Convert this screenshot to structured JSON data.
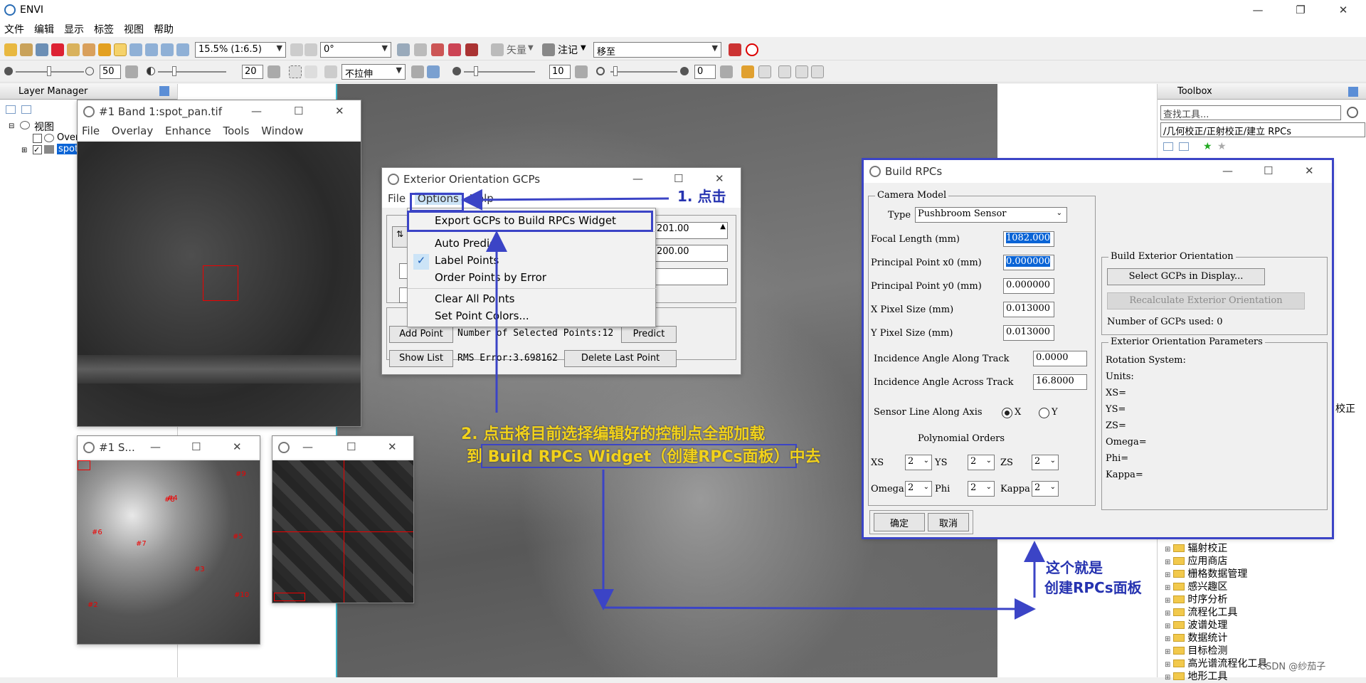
{
  "app": {
    "title": "ENVI",
    "min": "—",
    "restore": "❐",
    "close": "✕"
  },
  "menubar": [
    "文件",
    "编辑",
    "显示",
    "标签",
    "视图",
    "帮助"
  ],
  "toolbar1": {
    "zoom": "15.5% (1:6.5)",
    "rotation": "0°",
    "vector_label": "矢量",
    "annotation_label": "注记",
    "mode": "移至"
  },
  "toolbar2": {
    "brightness": "50",
    "contrast": "20",
    "stretch": "不拉伸",
    "sharpen": "10",
    "transparency": "0"
  },
  "layer_manager": {
    "title": "Layer Manager",
    "root": "视图",
    "items": [
      "Overview",
      "spot_pan.tif"
    ]
  },
  "toolbox": {
    "title": "Toolbox",
    "search_placeholder": "查找工具...",
    "path": "/几何校正/正射校正/建立 RPCs",
    "truncated_label": "校正",
    "tree": [
      "辐射校正",
      "应用商店",
      "栅格数据管理",
      "感兴趣区",
      "时序分析",
      "流程化工具",
      "波谱处理",
      "数据统计",
      "目标检测",
      "高光谱流程化工具",
      "地形工具"
    ]
  },
  "band_window": {
    "title": "#1 Band 1:spot_pan.tif",
    "menu": [
      "File",
      "Overlay",
      "Enhance",
      "Tools",
      "Window"
    ]
  },
  "scroll_window": {
    "title": "#1 S..."
  },
  "zoom_window": {
    "title": ""
  },
  "gcp_points": [
    "#9",
    "#4",
    "#8",
    "#6",
    "#7",
    "#5",
    "#3",
    "#10",
    "#2"
  ],
  "gcp_dialog": {
    "title": "Exterior Orientation GCPs",
    "menu": [
      "File",
      "Options",
      "Help"
    ],
    "options_menu": [
      "Export GCPs to Build RPCs Widget",
      "Auto Predict",
      "Label Points",
      "Order Points by Error",
      "Clear All Points",
      "Set Point Colors..."
    ],
    "val1": "201.00",
    "val2": "200.00",
    "add_point": "Add Point",
    "num_selected": "Number of Selected Points:12",
    "predict": "Predict",
    "show_list": "Show List",
    "rms": "RMS Error:3.698162",
    "delete_last": "Delete Last Point"
  },
  "build_rpcs": {
    "title": "Build RPCs",
    "camera_model": "Camera Model",
    "type_label": "Type",
    "type_value": "Pushbroom Sensor",
    "focal_label": "Focal Length (mm)",
    "focal_value": "1082.000",
    "ppx_label": "Principal Point x0 (mm)",
    "ppx_value": "0.000000",
    "ppy_label": "Principal Point y0 (mm)",
    "ppy_value": "0.000000",
    "xpix_label": "X Pixel Size (mm)",
    "xpix_value": "0.013000",
    "ypix_label": "Y Pixel Size (mm)",
    "ypix_value": "0.013000",
    "inc_along_label": "Incidence Angle Along Track",
    "inc_along_value": "0.0000",
    "inc_across_label": "Incidence Angle Across Track",
    "inc_across_value": "16.8000",
    "sensor_axis_label": "Sensor Line Along Axis",
    "axis_x": "X",
    "axis_y": "Y",
    "poly_title": "Polynomial Orders",
    "poly": [
      {
        "label": "XS",
        "value": "2"
      },
      {
        "label": "YS",
        "value": "2"
      },
      {
        "label": "ZS",
        "value": "2"
      },
      {
        "label": "Omega",
        "value": "2"
      },
      {
        "label": "Phi",
        "value": "2"
      },
      {
        "label": "Kappa",
        "value": "2"
      }
    ],
    "ok": "确定",
    "cancel": "取消",
    "beo_title": "Build Exterior Orientation",
    "select_gcps": "Select GCPs in Display...",
    "recalc": "Recalculate Exterior Orientation",
    "num_gcps": "Number of GCPs used: 0",
    "eop_title": "Exterior Orientation Parameters",
    "eop": [
      "Rotation System:",
      "Units:",
      "XS=",
      "YS=",
      "ZS=",
      "Omega=",
      "Phi=",
      "Kappa="
    ]
  },
  "annotations": {
    "step1": "1. 点击",
    "step2_line1": "2. 点击将目前选择编辑好的控制点全部加载",
    "step2_line2": "到 Build RPCs Widget（创建RPCs面板）中去",
    "panel_note_line1": "这个就是",
    "panel_note_line2": "创建RPCs面板"
  },
  "watermark": "CSDN @纱茄子"
}
